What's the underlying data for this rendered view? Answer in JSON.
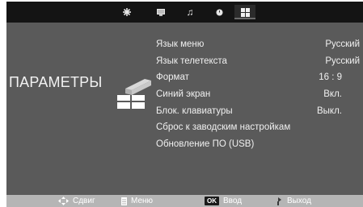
{
  "top_tabs": [
    {
      "icon": "picture-icon",
      "glyph": "✱"
    },
    {
      "icon": "monitor-icon",
      "glyph": "▪"
    },
    {
      "icon": "music-note-icon",
      "glyph": "♫"
    },
    {
      "icon": "clock-icon",
      "glyph": "●"
    },
    {
      "icon": "settings-grid-icon",
      "glyph": "▦",
      "active": true
    }
  ],
  "title": "ПАРАМЕТРЫ",
  "menu": [
    {
      "label": "Язык меню",
      "value": "Русский"
    },
    {
      "label": "Язык телетекста",
      "value": "Русский"
    },
    {
      "label": "Формат",
      "value": "16 : 9"
    },
    {
      "label": "Синий экран",
      "value": "Вкл."
    },
    {
      "label": "Блок. клавиатуры",
      "value": "Выкл."
    },
    {
      "label": "Сброс к заводским настройкам",
      "value": ""
    },
    {
      "label": "Обновление ПО (USB)",
      "value": ""
    }
  ],
  "bottom": {
    "move_label": "Сдвиг",
    "menu_label": "Меню",
    "ok_badge": "OK",
    "ok_label": "Ввод",
    "exit_label": "Выход"
  }
}
